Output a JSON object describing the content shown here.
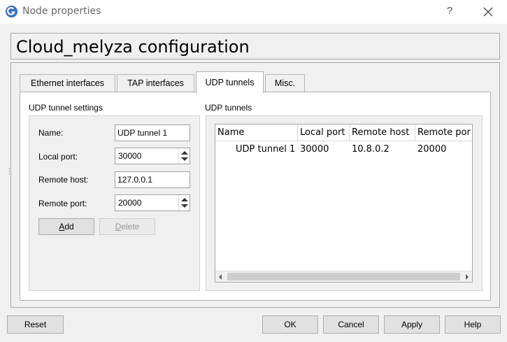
{
  "window": {
    "title": "Node properties",
    "help_glyph": "?",
    "close_glyph": "close"
  },
  "header": {
    "title": "Cloud_melyza configuration"
  },
  "tabs": [
    {
      "label": "Ethernet interfaces",
      "active": false
    },
    {
      "label": "TAP interfaces",
      "active": false
    },
    {
      "label": "UDP tunnels",
      "active": true
    },
    {
      "label": "Misc.",
      "active": false
    }
  ],
  "settings": {
    "section_title": "UDP tunnel settings",
    "name_label": "Name:",
    "name_value": "UDP tunnel 1",
    "local_port_label": "Local port:",
    "local_port_value": "30000",
    "remote_host_label": "Remote host:",
    "remote_host_value": "127.0.0.1",
    "remote_port_label": "Remote port:",
    "remote_port_value": "20000",
    "add_label_prefix": "",
    "add_label_mnemonic": "A",
    "add_label_rest": "dd",
    "delete_label_mnemonic": "D",
    "delete_label_rest": "elete"
  },
  "tunnels": {
    "section_title": "UDP tunnels",
    "columns": [
      "Name",
      "Local port",
      "Remote host",
      "Remote por"
    ],
    "rows": [
      [
        "UDP tunnel 1",
        "30000",
        "10.8.0.2",
        "20000"
      ]
    ]
  },
  "footer": {
    "reset": "Reset",
    "ok": "OK",
    "cancel": "Cancel",
    "apply": "Apply",
    "help": "Help"
  },
  "icons": {
    "app": "gns3-icon",
    "close": "close-icon",
    "spin_up": "chevron-up-icon",
    "spin_down": "chevron-down-icon",
    "scroll_left": "scroll-left-icon",
    "scroll_right": "scroll-right-icon"
  },
  "colors": {
    "accent": "#3a6fc4",
    "title_text": "#6a6a6a"
  }
}
